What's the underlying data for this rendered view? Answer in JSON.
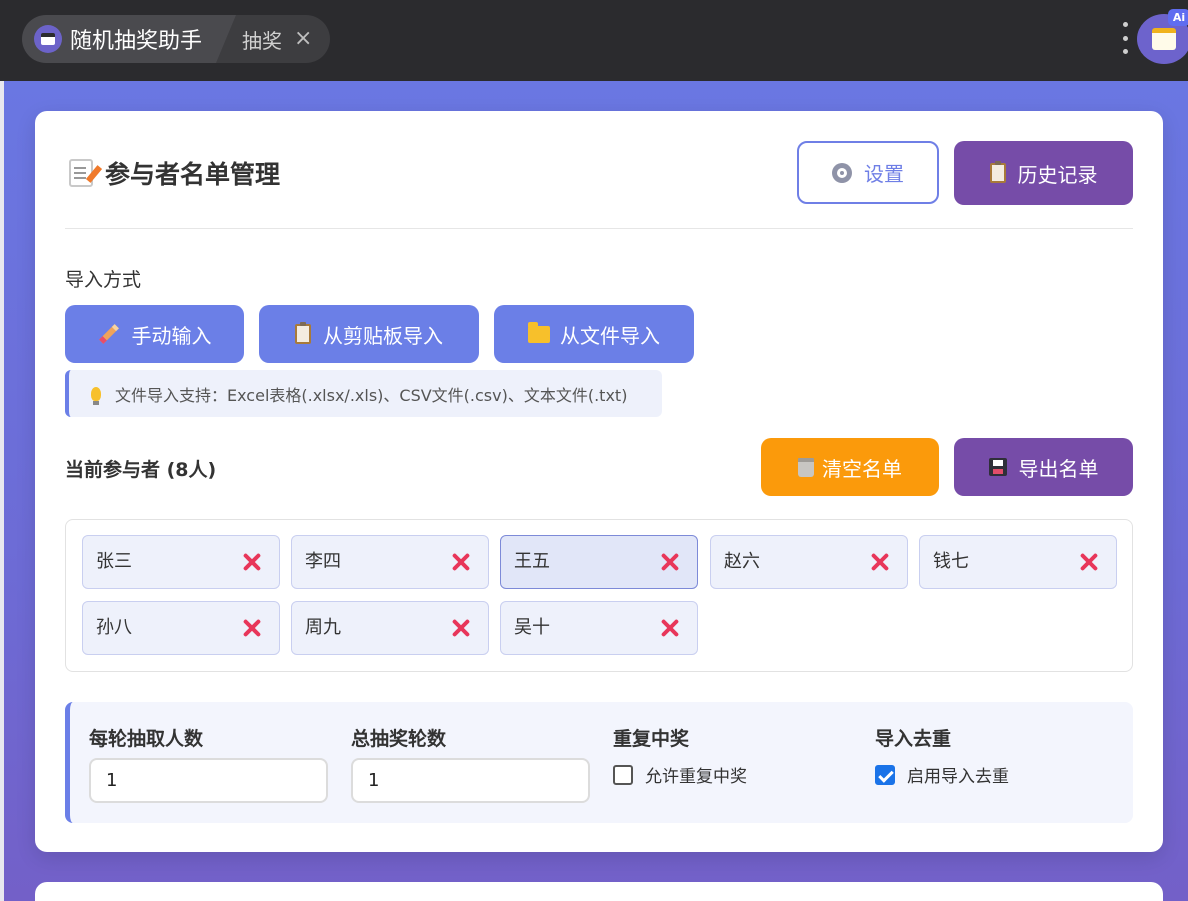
{
  "window": {
    "app_title": "随机抽奖助手",
    "tab_label": "抽奖",
    "tab_close_glyph": "×",
    "ai_badge": "Ai"
  },
  "card": {
    "title": "参与者名单管理",
    "settings_label": "设置",
    "history_label": "历史记录"
  },
  "import": {
    "section_label": "导入方式",
    "manual_label": "手动输入",
    "clipboard_label": "从剪贴板导入",
    "file_label": "从文件导入",
    "tip": "文件导入支持：Excel表格(.xlsx/.xls)、CSV文件(.csv)、文本文件(.txt)"
  },
  "participants": {
    "label": "当前参与者 (8人)",
    "clear_label": "清空名单",
    "export_label": "导出名单",
    "names": [
      "张三",
      "李四",
      "王五",
      "赵六",
      "钱七",
      "孙八",
      "周九",
      "吴十"
    ],
    "selected": "王五"
  },
  "settings": {
    "per_round_label": "每轮抽取人数",
    "per_round_value": "1",
    "rounds_label": "总抽奖轮数",
    "rounds_value": "1",
    "repeat_label": "重复中奖",
    "repeat_option": "允许重复中奖",
    "repeat_checked": false,
    "dedupe_label": "导入去重",
    "dedupe_option": "启用导入去重",
    "dedupe_checked": true
  },
  "colors": {
    "primary": "#6b7fe7",
    "purple": "#764ca8",
    "orange": "#fb9a0b",
    "remove_red": "#e8365a"
  }
}
